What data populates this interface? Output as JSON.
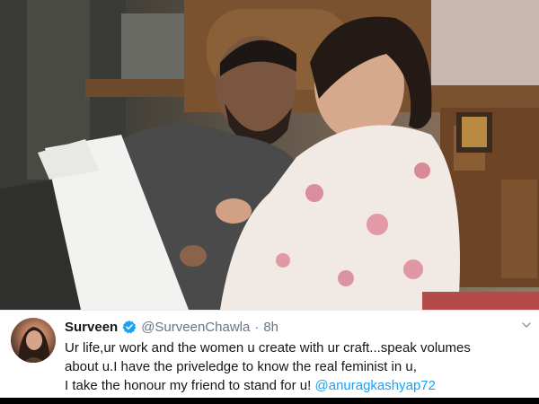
{
  "tweet": {
    "display_name": "Surveen",
    "handle": "@SurveenChawla",
    "separator": "·",
    "time": "8h",
    "text_line_1": "Ur life,ur work and the women u create with ur craft...speak volumes",
    "text_line_2": "about u.I have the priveledge to know the real feminist in u,",
    "text_line_3_prefix": "I take the honour my friend to stand for u! ",
    "mention": "@anuragkashyap72",
    "verified_icon": "verified-icon",
    "menu_icon": "chevron-down-icon"
  },
  "colors": {
    "name": "#14171a",
    "secondary": "#657786",
    "link": "#1da1f2",
    "verified": "#1da1f2"
  }
}
